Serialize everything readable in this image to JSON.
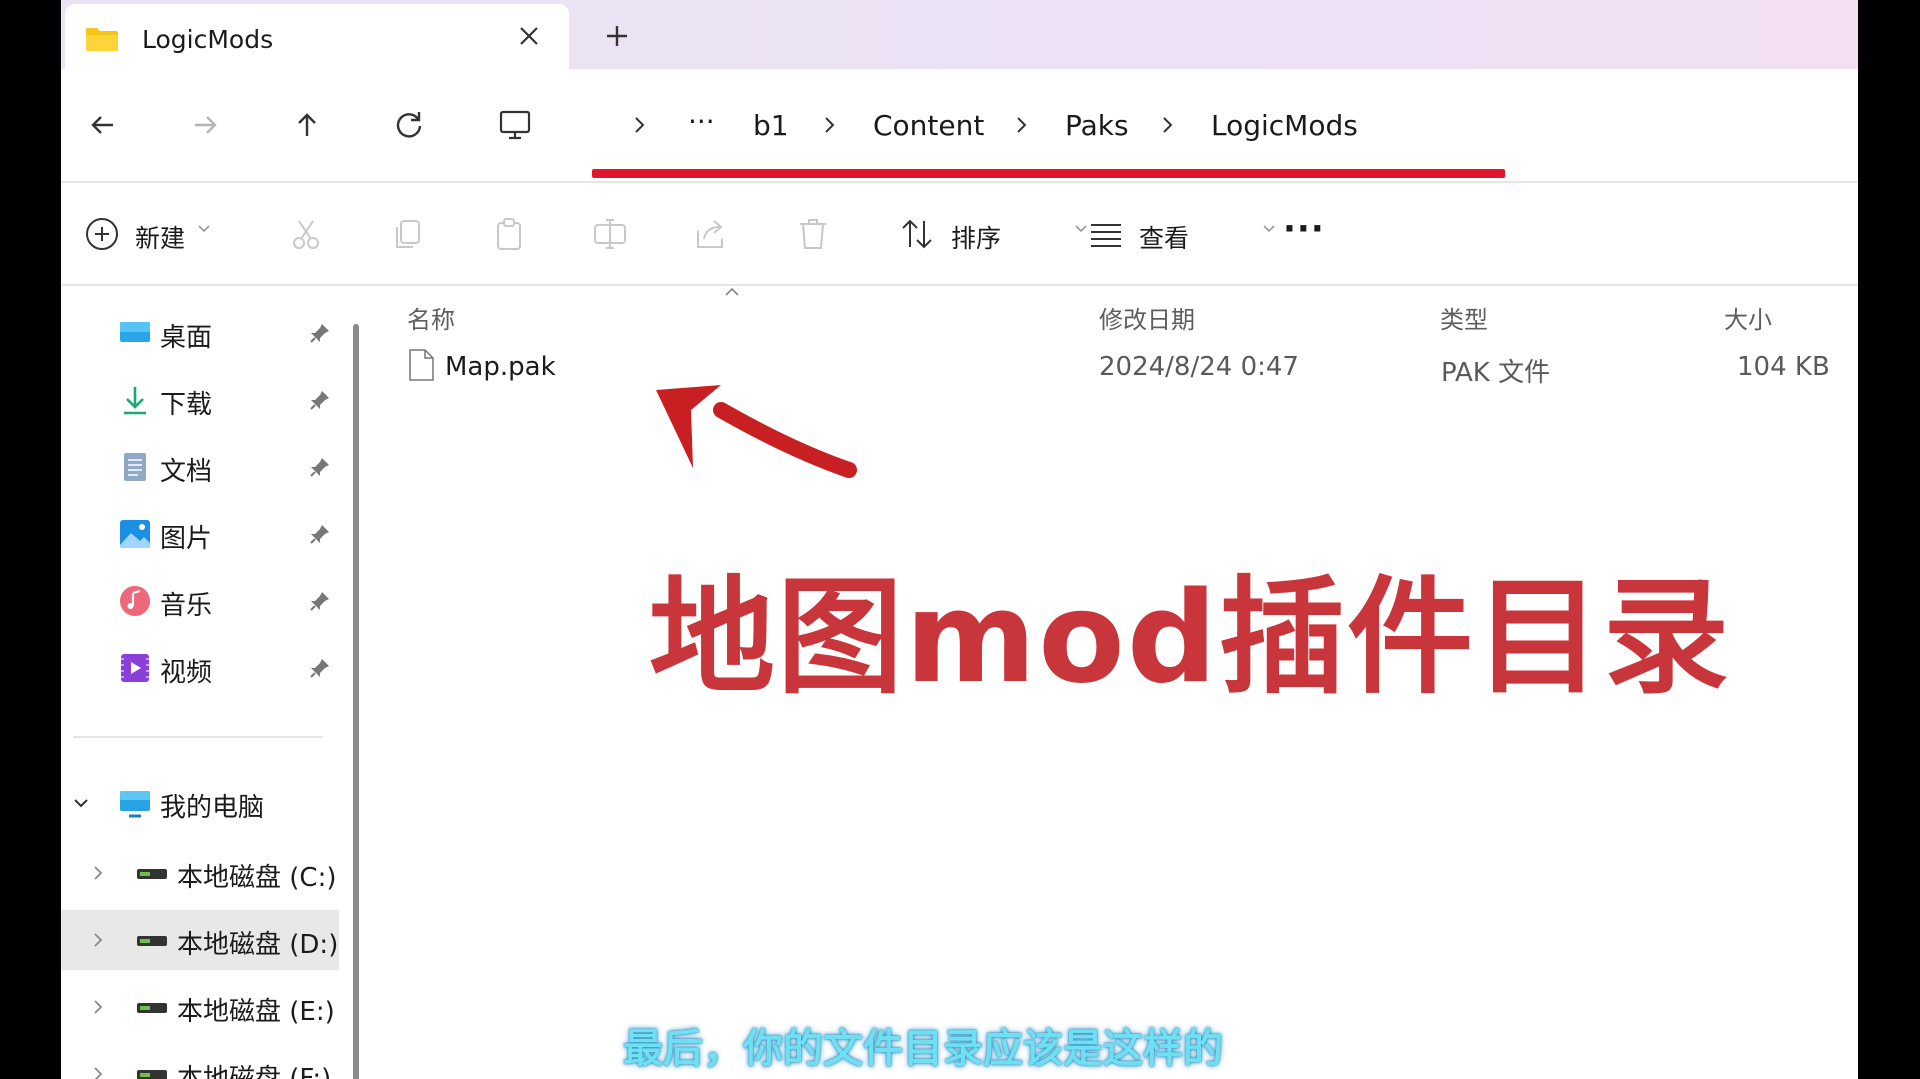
{
  "tab": {
    "title": "LogicMods",
    "close_icon": "close-icon",
    "new_tab_icon": "plus-icon"
  },
  "nav": {
    "back": "arrow-left-icon",
    "forward": "arrow-right-icon",
    "up": "arrow-up-icon",
    "refresh": "refresh-icon"
  },
  "breadcrumb": {
    "overflow": "···",
    "items": [
      "b1",
      "Content",
      "Paks",
      "LogicMods"
    ]
  },
  "toolbar": {
    "new_label": "新建",
    "sort_label": "排序",
    "view_label": "查看",
    "more": "···",
    "icons": [
      "cut-icon",
      "copy-icon",
      "paste-icon",
      "rename-icon",
      "share-icon",
      "delete-icon"
    ]
  },
  "sidebar": {
    "quick_access": [
      {
        "label": "桌面",
        "icon": "desktop-icon"
      },
      {
        "label": "下载",
        "icon": "download-icon"
      },
      {
        "label": "文档",
        "icon": "document-icon"
      },
      {
        "label": "图片",
        "icon": "pictures-icon"
      },
      {
        "label": "音乐",
        "icon": "music-icon"
      },
      {
        "label": "视频",
        "icon": "video-icon"
      }
    ],
    "this_pc": "我的电脑",
    "drives": [
      "本地磁盘 (C:)",
      "本地磁盘 (D:)",
      "本地磁盘 (E:)",
      "本地磁盘 (F:)"
    ],
    "selected_drive": "本地磁盘 (D:)"
  },
  "columns": {
    "name": "名称",
    "modified": "修改日期",
    "type": "类型",
    "size": "大小"
  },
  "files": [
    {
      "name": "Map.pak",
      "modified": "2024/8/24 0:47",
      "type": "PAK 文件",
      "size": "104 KB"
    }
  ],
  "overlay": {
    "title": "地图mod插件目录",
    "subtitle": "最后，你的文件目录应该是这样的"
  },
  "colors": {
    "annotation_red": "#c8353b",
    "underline_red": "#e3152d",
    "subtitle_cyan": "#6fe0f2"
  }
}
